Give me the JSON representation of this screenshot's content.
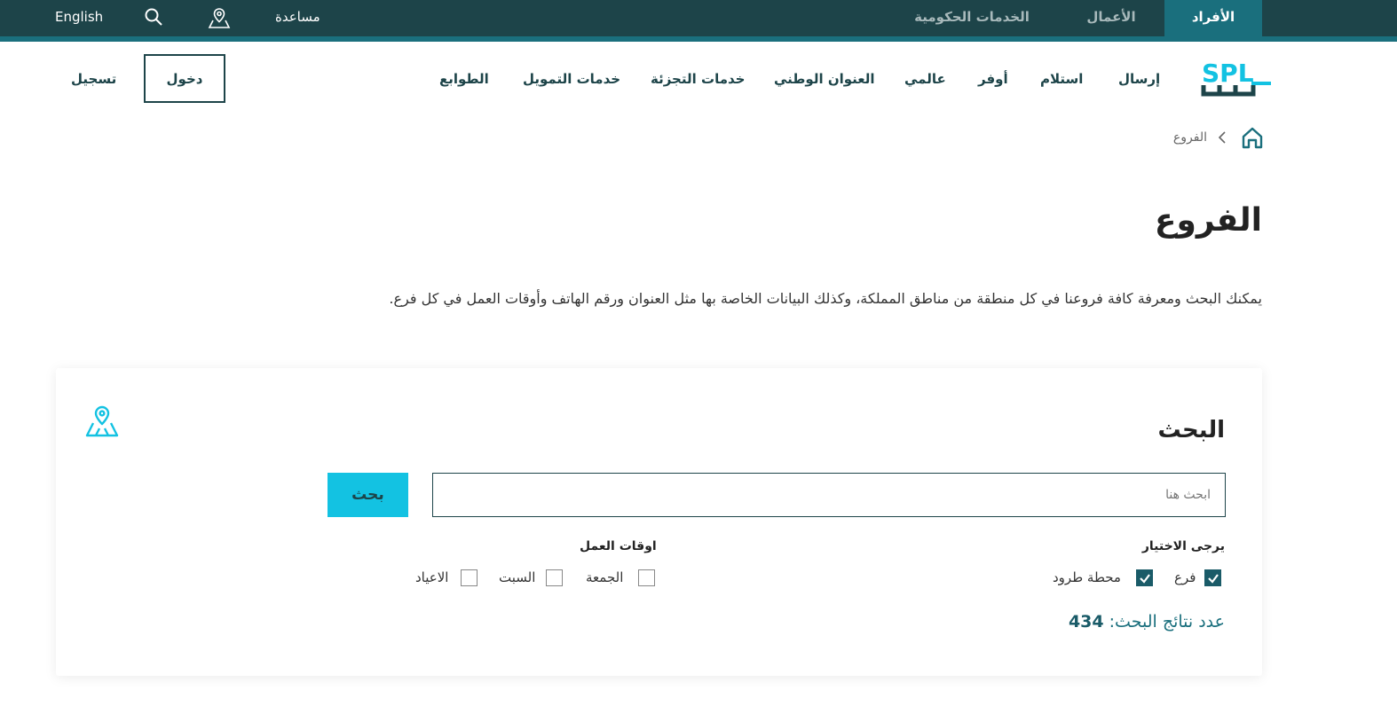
{
  "topbar": {
    "tabs": [
      {
        "label": "الأفراد",
        "active": true
      },
      {
        "label": "الأعمال",
        "active": false
      },
      {
        "label": "الخدمات الحكومية",
        "active": false
      }
    ],
    "help_label": "مساعدة",
    "language_label": "English",
    "icons": [
      "location-map-icon",
      "search-icon"
    ]
  },
  "header": {
    "logo_text": "SPL",
    "nav": [
      "إرسال",
      "استلام",
      "أوفر",
      "عالمي",
      "العنوان الوطني",
      "خدمات التجزئة",
      "خدمات التمويل",
      "الطوابع"
    ],
    "login_label": "دخول",
    "register_label": "تسجيل"
  },
  "breadcrumb": {
    "current": "الفروع"
  },
  "page": {
    "title": "الفروع",
    "intro": "يمكنك البحث ومعرفة كافة فروعنا في كل منطقة من مناطق المملكة، وكذلك البيانات الخاصة بها مثل العنوان ورقم الهاتف وأوقات العمل في كل فرع."
  },
  "search": {
    "title": "البحث",
    "placeholder": "ابحث هنا",
    "value": "",
    "button_label": "بحث",
    "type_group_label": "يرجى الاختيار",
    "type_options": [
      {
        "label": "فرع",
        "checked": true
      },
      {
        "label": "محطة طرود",
        "checked": true
      }
    ],
    "hours_group_label": "اوقات العمل",
    "hours_options": [
      {
        "label": "الجمعة",
        "checked": false
      },
      {
        "label": "السبت",
        "checked": false
      },
      {
        "label": "الاعياد",
        "checked": false
      }
    ],
    "results_label": "عدد نتائج البحث:",
    "results_count": "434"
  },
  "colors": {
    "topbar": "#1d4449",
    "accent": "#1a6f7d",
    "cyan": "#13c2e2",
    "checkbox": "#1a5b68"
  }
}
